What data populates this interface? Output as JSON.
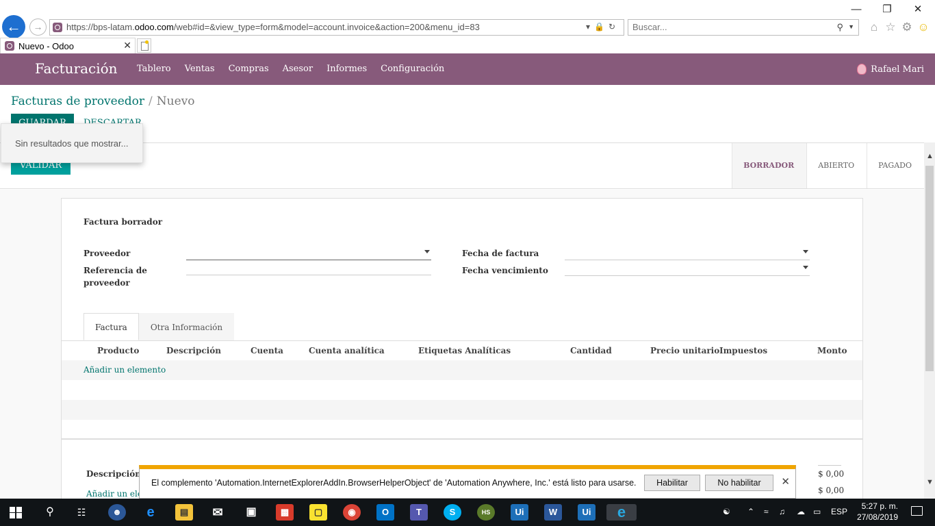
{
  "browser": {
    "url_prefix": "https://bps-latam.",
    "url_host": "odoo.com",
    "url_suffix": "/web#id=&view_type=form&model=account.invoice&action=200&menu_id=83",
    "search_placeholder": "Buscar...",
    "tab_title": "Nuevo - Odoo"
  },
  "navbar": {
    "brand": "Facturación",
    "menu": [
      "Tablero",
      "Ventas",
      "Compras",
      "Asesor",
      "Informes",
      "Configuración"
    ],
    "user": "Rafael Mari"
  },
  "control": {
    "breadcrumb_parent": "Facturas de proveedor",
    "breadcrumb_separator": "/",
    "breadcrumb_current": "Nuevo",
    "save_label": "GUARDAR",
    "discard_label": "DESCARTAR"
  },
  "dropdown": {
    "message": "Sin resultados que mostrar..."
  },
  "statusbar": {
    "validate_label": "VALIDAR",
    "steps": [
      "BORRADOR",
      "ABIERTO",
      "PAGADO"
    ],
    "active_step": "BORRADOR"
  },
  "form": {
    "title": "Factura borrador",
    "vendor_label": "Proveedor",
    "vendor_ref_label": "Referencia de proveedor",
    "invoice_date_label": "Fecha de factura",
    "due_date_label": "Fecha vencimiento",
    "tabs": [
      "Factura",
      "Otra Información"
    ],
    "columns": [
      "Producto",
      "Descripción",
      "Cuenta",
      "Cuenta analítica",
      "Etiquetas Analíticas",
      "Cantidad",
      "Precio unitario",
      "Impuestos",
      "Monto"
    ],
    "add_line": "Añadir un elemento",
    "tax_desc_label": "Descripción d",
    "tax_add_line": "Añadir un elem",
    "amount_1": "$ 0,00",
    "amount_2": "$ 0,00"
  },
  "notification": {
    "message": "El complemento 'Automation.InternetExplorerAddIn.BrowserHelperObject' de 'Automation Anywhere, Inc.' está listo para usarse.",
    "enable_label": "Habilitar",
    "disable_label": "No habilitar"
  },
  "taskbar": {
    "language": "ESP",
    "time": "5:27 p. m.",
    "date": "27/08/2019"
  },
  "colors": {
    "brand": "#875a7b",
    "primary": "#00746d",
    "validate": "#00a09d",
    "notification_bar": "#f0a500"
  }
}
